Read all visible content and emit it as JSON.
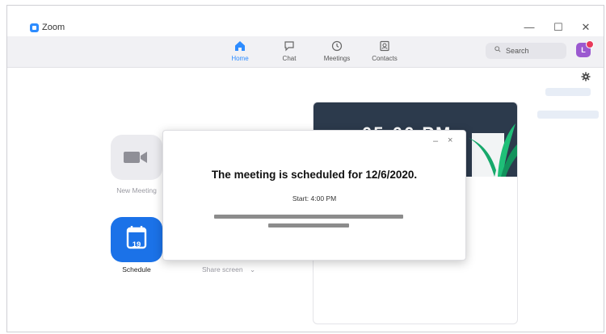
{
  "window": {
    "app_title": "Zoom",
    "controls": {
      "minimize": "—",
      "maximize": "☐",
      "close": "✕"
    }
  },
  "nav": {
    "tabs": [
      {
        "label": "Home",
        "icon": "home-icon",
        "active": true
      },
      {
        "label": "Chat",
        "icon": "chat-icon",
        "active": false
      },
      {
        "label": "Meetings",
        "icon": "clock-icon",
        "active": false
      },
      {
        "label": "Contacts",
        "icon": "contacts-icon",
        "active": false
      }
    ],
    "search_placeholder": "Search",
    "avatar_initial": "L"
  },
  "actions": {
    "new_meeting": "New Meeting",
    "schedule": "Schedule",
    "schedule_day": "19",
    "share_screen": "Share screen",
    "share_screen_chevron": "⌄"
  },
  "card": {
    "time": "05:06 PM"
  },
  "dialog": {
    "title": "The meeting is scheduled for 12/6/2020.",
    "start": "Start: 4:00 PM",
    "min_glyph": "–",
    "close_glyph": "×"
  },
  "colors": {
    "accent": "#2d8cff",
    "schedule_button": "#1b72e8",
    "card_banner": "#2c3a4c",
    "avatar": "#9b59d0"
  }
}
